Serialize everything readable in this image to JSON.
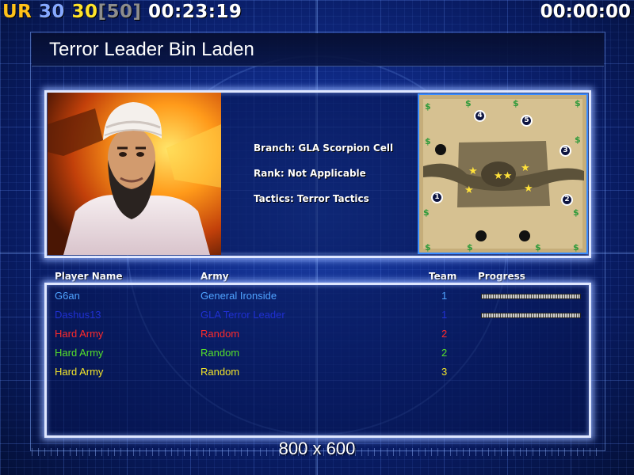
{
  "hud": {
    "tag": "UR",
    "current_units": "30",
    "unit_value": "30",
    "unit_cap": "[50]",
    "elapsed_time": "00:23:19",
    "countdown": "00:00:00"
  },
  "general": {
    "title": "Terror Leader Bin Laden",
    "branch": "Branch: GLA Scorpion Cell",
    "rank": "Rank: Not Applicable",
    "tactics": "Tactics: Terror Tactics"
  },
  "minimap": {
    "start_positions": [
      "1",
      "2",
      "3",
      "4",
      "5"
    ]
  },
  "players_table": {
    "headers": {
      "name": "Player Name",
      "army": "Army",
      "team": "Team",
      "progress": "Progress"
    },
    "rows": [
      {
        "name": "G6an",
        "army": "General Ironside",
        "team": "1",
        "color": "#4fa3ff",
        "progress_bar": true
      },
      {
        "name": "Dashus13",
        "army": "GLA Terror Leader",
        "team": "1",
        "color": "#1f2fd0",
        "progress_bar": true
      },
      {
        "name": "Hard Army",
        "army": "Random",
        "team": "2",
        "color": "#ff2a2a",
        "progress_bar": false
      },
      {
        "name": "Hard Army",
        "army": "Random",
        "team": "2",
        "color": "#56e02a",
        "progress_bar": false
      },
      {
        "name": "Hard Army",
        "army": "Random",
        "team": "3",
        "color": "#f2e42a",
        "progress_bar": false
      }
    ]
  },
  "resolution_label": "800 x 600"
}
